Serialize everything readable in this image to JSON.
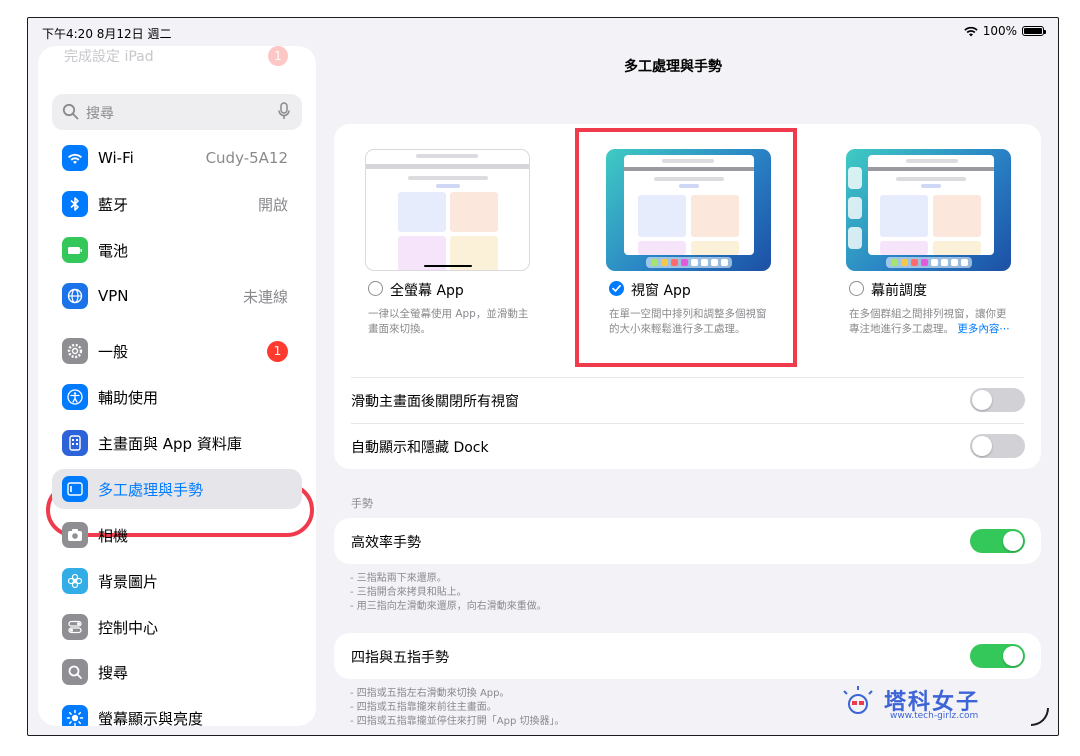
{
  "status": {
    "time_date": "下午4:20  8月12日 週二",
    "battery": "100%"
  },
  "sidebar": {
    "setup": {
      "label": "完成設定 iPad",
      "badge": "1"
    },
    "search_placeholder": "搜尋",
    "items": [
      {
        "label": "Wi-Fi",
        "value": "Cudy-5A12",
        "color": "#007aff",
        "icon": "wifi-icon"
      },
      {
        "label": "藍牙",
        "value": "開啟",
        "color": "#007aff",
        "icon": "bluetooth-icon"
      },
      {
        "label": "電池",
        "value": "",
        "color": "#34c759",
        "icon": "battery-icon"
      },
      {
        "label": "VPN",
        "value": "未連線",
        "color": "#1a73e8",
        "icon": "globe-icon"
      },
      {
        "label": "一般",
        "badge": "1",
        "color": "#8e8e93",
        "icon": "gear-icon"
      },
      {
        "label": "輔助使用",
        "value": "",
        "color": "#007aff",
        "icon": "accessibility-icon"
      },
      {
        "label": "主畫面與 App 資料庫",
        "value": "",
        "color": "#2c63d9",
        "icon": "home-screen-icon"
      },
      {
        "label": "多工處理與手勢",
        "value": "",
        "color": "#007aff",
        "icon": "multitasking-icon",
        "active": true
      },
      {
        "label": "相機",
        "value": "",
        "color": "#8e8e93",
        "icon": "camera-icon"
      },
      {
        "label": "背景圖片",
        "value": "",
        "color": "#32ade6",
        "icon": "flower-icon"
      },
      {
        "label": "控制中心",
        "value": "",
        "color": "#8e8e93",
        "icon": "toggles-icon"
      },
      {
        "label": "搜尋",
        "value": "",
        "color": "#8e8e93",
        "icon": "search-icon"
      },
      {
        "label": "螢幕顯示與亮度",
        "value": "",
        "color": "#007aff",
        "icon": "sun-icon"
      }
    ]
  },
  "main": {
    "title": "多工處理與手勢",
    "modes": [
      {
        "name": "全螢幕 App",
        "desc": "一律以全螢幕使用 App，並滑動主畫面來切換。",
        "selected": false
      },
      {
        "name": "視窗 App",
        "desc": "在單一空間中排列和調整多個視窗的大小來輕鬆進行多工處理。",
        "selected": true
      },
      {
        "name": "幕前調度",
        "desc": "在多個群組之間排列視窗，讓你更專注地進行多工處理。",
        "more": "更多內容⋯",
        "selected": false
      }
    ],
    "toggles": [
      {
        "label": "滑動主畫面後關閉所有視窗",
        "on": false
      },
      {
        "label": "自動顯示和隱藏 Dock",
        "on": false
      }
    ],
    "gestures_header": "手勢",
    "gesture1": {
      "label": "高效率手勢",
      "on": true,
      "notes": [
        "- 三指點兩下來還原。",
        "- 三指開合來拷貝和貼上。",
        "- 用三指向左滑動來還原，向右滑動來重做。"
      ]
    },
    "gesture2": {
      "label": "四指與五指手勢",
      "on": true,
      "notes": [
        "- 四指或五指左右滑動來切換 App。",
        "- 四指或五指靠攏來前往主畫面。",
        "- 四指或五指靠攏並停住來打開「App 切換器」。"
      ]
    }
  },
  "watermark": {
    "title": "塔科女子",
    "url": "www.tech-girlz.com"
  }
}
